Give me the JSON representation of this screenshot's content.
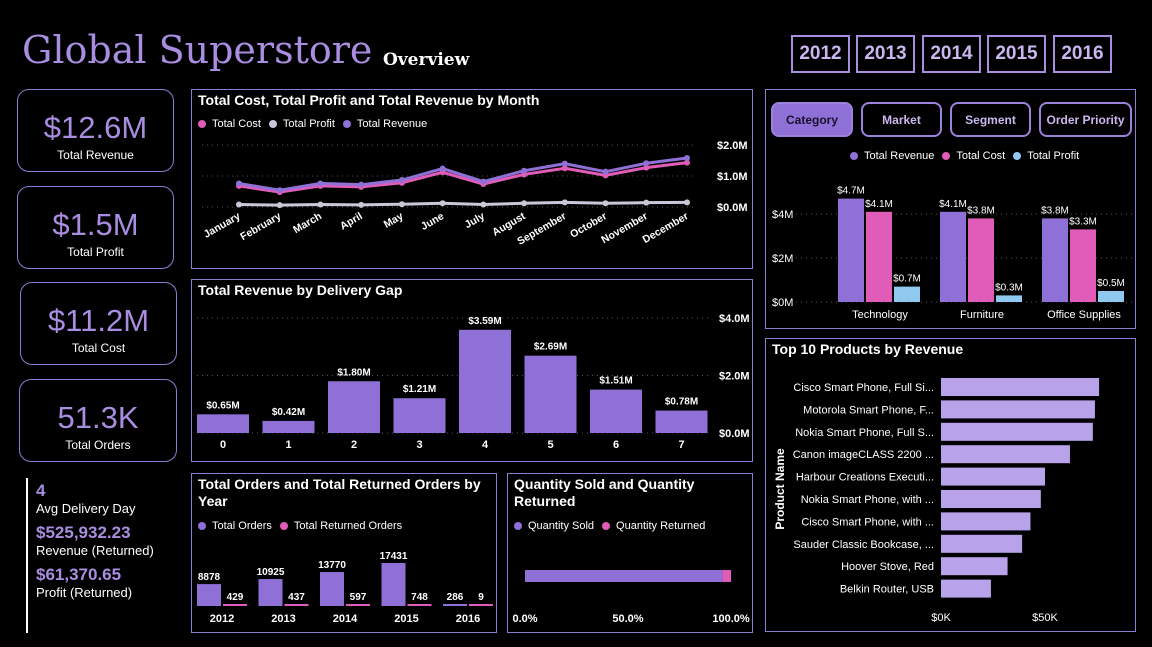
{
  "header": {
    "title": "Global Superstore",
    "subtitle": "Overview",
    "years": [
      "2012",
      "2013",
      "2014",
      "2015",
      "2016"
    ]
  },
  "kpis": [
    {
      "value": "$12.6M",
      "label": "Total Revenue"
    },
    {
      "value": "$1.5M",
      "label": "Total Profit"
    },
    {
      "value": "$11.2M",
      "label": "Total Cost"
    },
    {
      "value": "51.3K",
      "label": "Total Orders"
    }
  ],
  "stats": {
    "avg_delivery_value": "4",
    "avg_delivery_label": "Avg Delivery Day",
    "rev_returned_value": "$525,932.23",
    "rev_returned_label": "Revenue (Returned)",
    "profit_returned_value": "$61,370.65",
    "profit_returned_label": "Profit (Returned)"
  },
  "colors": {
    "purple": "#8f70d6",
    "pink": "#e05cb8",
    "lightblue": "#8fc9f0",
    "lavender": "#b8a2ea",
    "grey": "#c8c8d8"
  },
  "tabs": [
    "Category",
    "Market",
    "Segment",
    "Order Priority"
  ],
  "chart_data": [
    {
      "type": "line",
      "title": "Total Cost, Total Profit and Total Revenue by Month",
      "categories": [
        "January",
        "February",
        "March",
        "April",
        "May",
        "June",
        "July",
        "August",
        "September",
        "October",
        "November",
        "December"
      ],
      "yticks": [
        "$2.0M",
        "$1.0M",
        "$0.0M"
      ],
      "ylim": [
        0,
        2.0
      ],
      "series": [
        {
          "name": "Total Cost",
          "color": "#e05cb8",
          "values": [
            0.68,
            0.48,
            0.68,
            0.65,
            0.78,
            1.12,
            0.74,
            1.05,
            1.25,
            1.02,
            1.27,
            1.43
          ]
        },
        {
          "name": "Total Profit",
          "color": "#c8c8d8",
          "values": [
            0.08,
            0.06,
            0.08,
            0.07,
            0.09,
            0.12,
            0.08,
            0.12,
            0.15,
            0.12,
            0.14,
            0.15
          ]
        },
        {
          "name": "Total Revenue",
          "color": "#8f70d6",
          "values": [
            0.76,
            0.54,
            0.76,
            0.72,
            0.87,
            1.24,
            0.82,
            1.17,
            1.4,
            1.14,
            1.41,
            1.58
          ]
        }
      ]
    },
    {
      "type": "bar",
      "title": "Total Revenue by Delivery Gap",
      "categories": [
        "0",
        "1",
        "2",
        "3",
        "4",
        "5",
        "6",
        "7"
      ],
      "values": [
        0.65,
        0.42,
        1.8,
        1.21,
        3.59,
        2.69,
        1.51,
        0.78
      ],
      "labels": [
        "$0.65M",
        "$0.42M",
        "$1.80M",
        "$1.21M",
        "$3.59M",
        "$2.69M",
        "$1.51M",
        "$0.78M"
      ],
      "yticks": [
        "$4.0M",
        "$2.0M",
        "$0.0M"
      ],
      "ylim": [
        0,
        4.0
      ]
    },
    {
      "type": "bar",
      "title": "Total Orders and Total Returned Orders by Year",
      "categories": [
        "2012",
        "2013",
        "2014",
        "2015",
        "2016"
      ],
      "series": [
        {
          "name": "Total Orders",
          "color": "#8f70d6",
          "values": [
            8878,
            10925,
            13770,
            17431,
            286
          ]
        },
        {
          "name": "Total Returned Orders",
          "color": "#e05cb8",
          "values": [
            429,
            437,
            597,
            748,
            9
          ]
        }
      ]
    },
    {
      "type": "bar",
      "title": "Quantity Sold and Quantity Returned",
      "xticks": [
        "0.0%",
        "50.0%",
        "100.0%"
      ],
      "series": [
        {
          "name": "Quantity Sold",
          "color": "#8f70d6",
          "values": [
            0.958
          ]
        },
        {
          "name": "Quantity Returned",
          "color": "#e05cb8",
          "values": [
            0.042
          ]
        }
      ]
    },
    {
      "type": "bar",
      "categories": [
        "Technology",
        "Furniture",
        "Office Supplies"
      ],
      "yticks": [
        "$4M",
        "$2M",
        "$0M"
      ],
      "ylim": [
        0,
        5
      ],
      "series": [
        {
          "name": "Total Revenue",
          "color": "#8f70d6",
          "values": [
            4.7,
            4.1,
            3.8
          ],
          "labels": [
            "$4.7M",
            "$4.1M",
            "$3.8M"
          ]
        },
        {
          "name": "Total Cost",
          "color": "#e05cb8",
          "values": [
            4.1,
            3.8,
            3.3
          ],
          "labels": [
            "$4.1M",
            "$3.8M",
            "$3.3M"
          ]
        },
        {
          "name": "Total Profit",
          "color": "#8fc9f0",
          "values": [
            0.7,
            0.3,
            0.5
          ],
          "labels": [
            "$0.7M",
            "$0.3M",
            "$0.5M"
          ]
        }
      ]
    },
    {
      "type": "bar",
      "title": "Top 10 Products by Revenue",
      "ylabel": "Product Name",
      "categories": [
        "Cisco Smart Phone, Full Si...",
        "Motorola Smart Phone, F...",
        "Nokia Smart Phone, Full S...",
        "Canon imageCLASS 2200 ...",
        "Harbour Creations Executi...",
        "Nokia Smart Phone, with ...",
        "Cisco Smart Phone, with ...",
        "Sauder Classic Bookcase, ...",
        "Hoover Stove, Red",
        "Belkin Router, USB"
      ],
      "values": [
        76,
        74,
        73,
        62,
        50,
        48,
        43,
        39,
        32,
        24
      ],
      "xticks": [
        "$0K",
        "$50K"
      ],
      "xlim": [
        0,
        80
      ]
    }
  ]
}
